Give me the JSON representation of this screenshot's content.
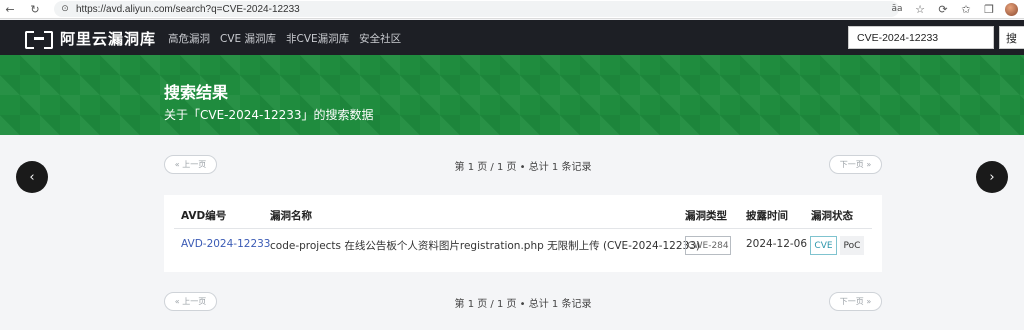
{
  "browser": {
    "url": "https://avd.aliyun.com/search?q=CVE-2024-12233",
    "translate_glyph": "āa"
  },
  "header": {
    "logo_text": "阿里云漏洞库",
    "nav": [
      "高危漏洞",
      "CVE 漏洞库",
      "非CVE漏洞库",
      "安全社区"
    ],
    "search_value": "CVE-2024-12233",
    "search_button": "搜"
  },
  "banner": {
    "title": "搜索结果",
    "subtitle": "关于「CVE-2024-12233」的搜索数据"
  },
  "pagination": {
    "prev": "« 上一页",
    "next": "下一页 »",
    "info": "第 1 页 / 1 页 • 总计 1 条记录"
  },
  "table": {
    "headers": [
      "AVD编号",
      "漏洞名称",
      "漏洞类型",
      "披露时间",
      "漏洞状态"
    ],
    "rows": [
      {
        "avd_id": "AVD-2024-12233",
        "name": "code-projects 在线公告板个人资料图片registration.php 无限制上传 (CVE-2024-12233)",
        "type": "CWE-284",
        "date": "2024-12-06",
        "status": [
          "CVE",
          "PoC"
        ]
      }
    ]
  },
  "carousel": {
    "left": "‹",
    "right": "›"
  },
  "colors": {
    "header_bg": "#1d1f25",
    "banner_bg": "#1f8c3e",
    "link": "#3b5bb5",
    "cve_tag": "#2e96ab"
  }
}
